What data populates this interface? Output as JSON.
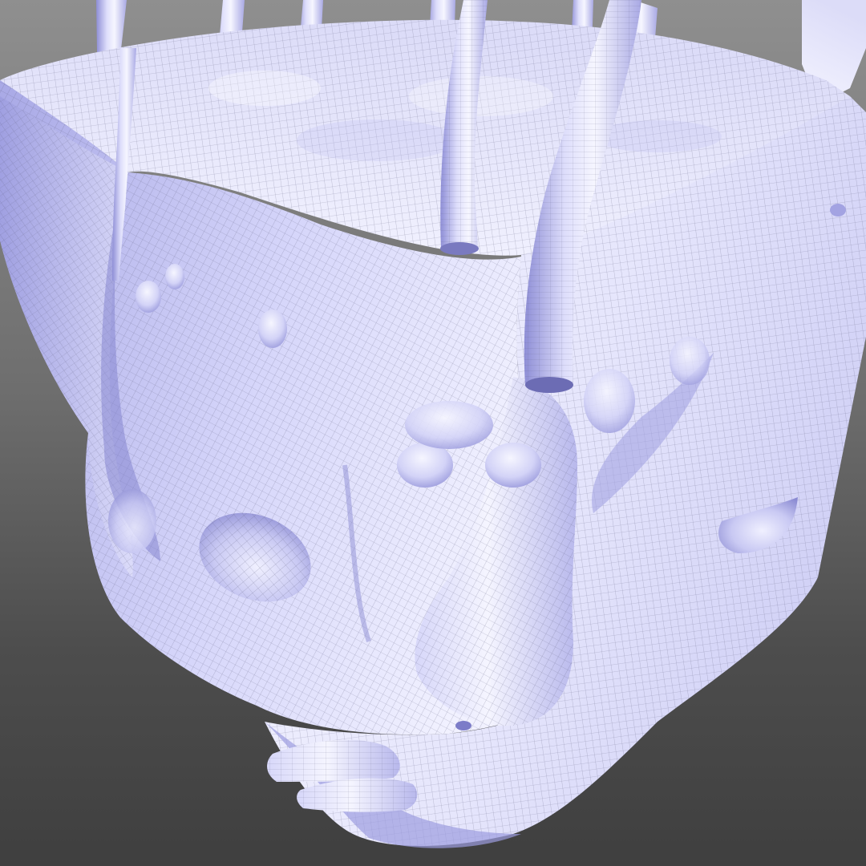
{
  "viewport": {
    "mode": "3d-perspective",
    "shading": "smooth-with-wireframe",
    "background": {
      "top": "#8f8f8f",
      "bottom": "#3f3f3f"
    }
  },
  "model": {
    "kind": "sculpted-cube-mesh",
    "surface_color": "#cfcff7",
    "shadow_color": "#8c8ccc",
    "highlight_color": "#f2f2ff",
    "wire_color": "#6a6a8a"
  }
}
